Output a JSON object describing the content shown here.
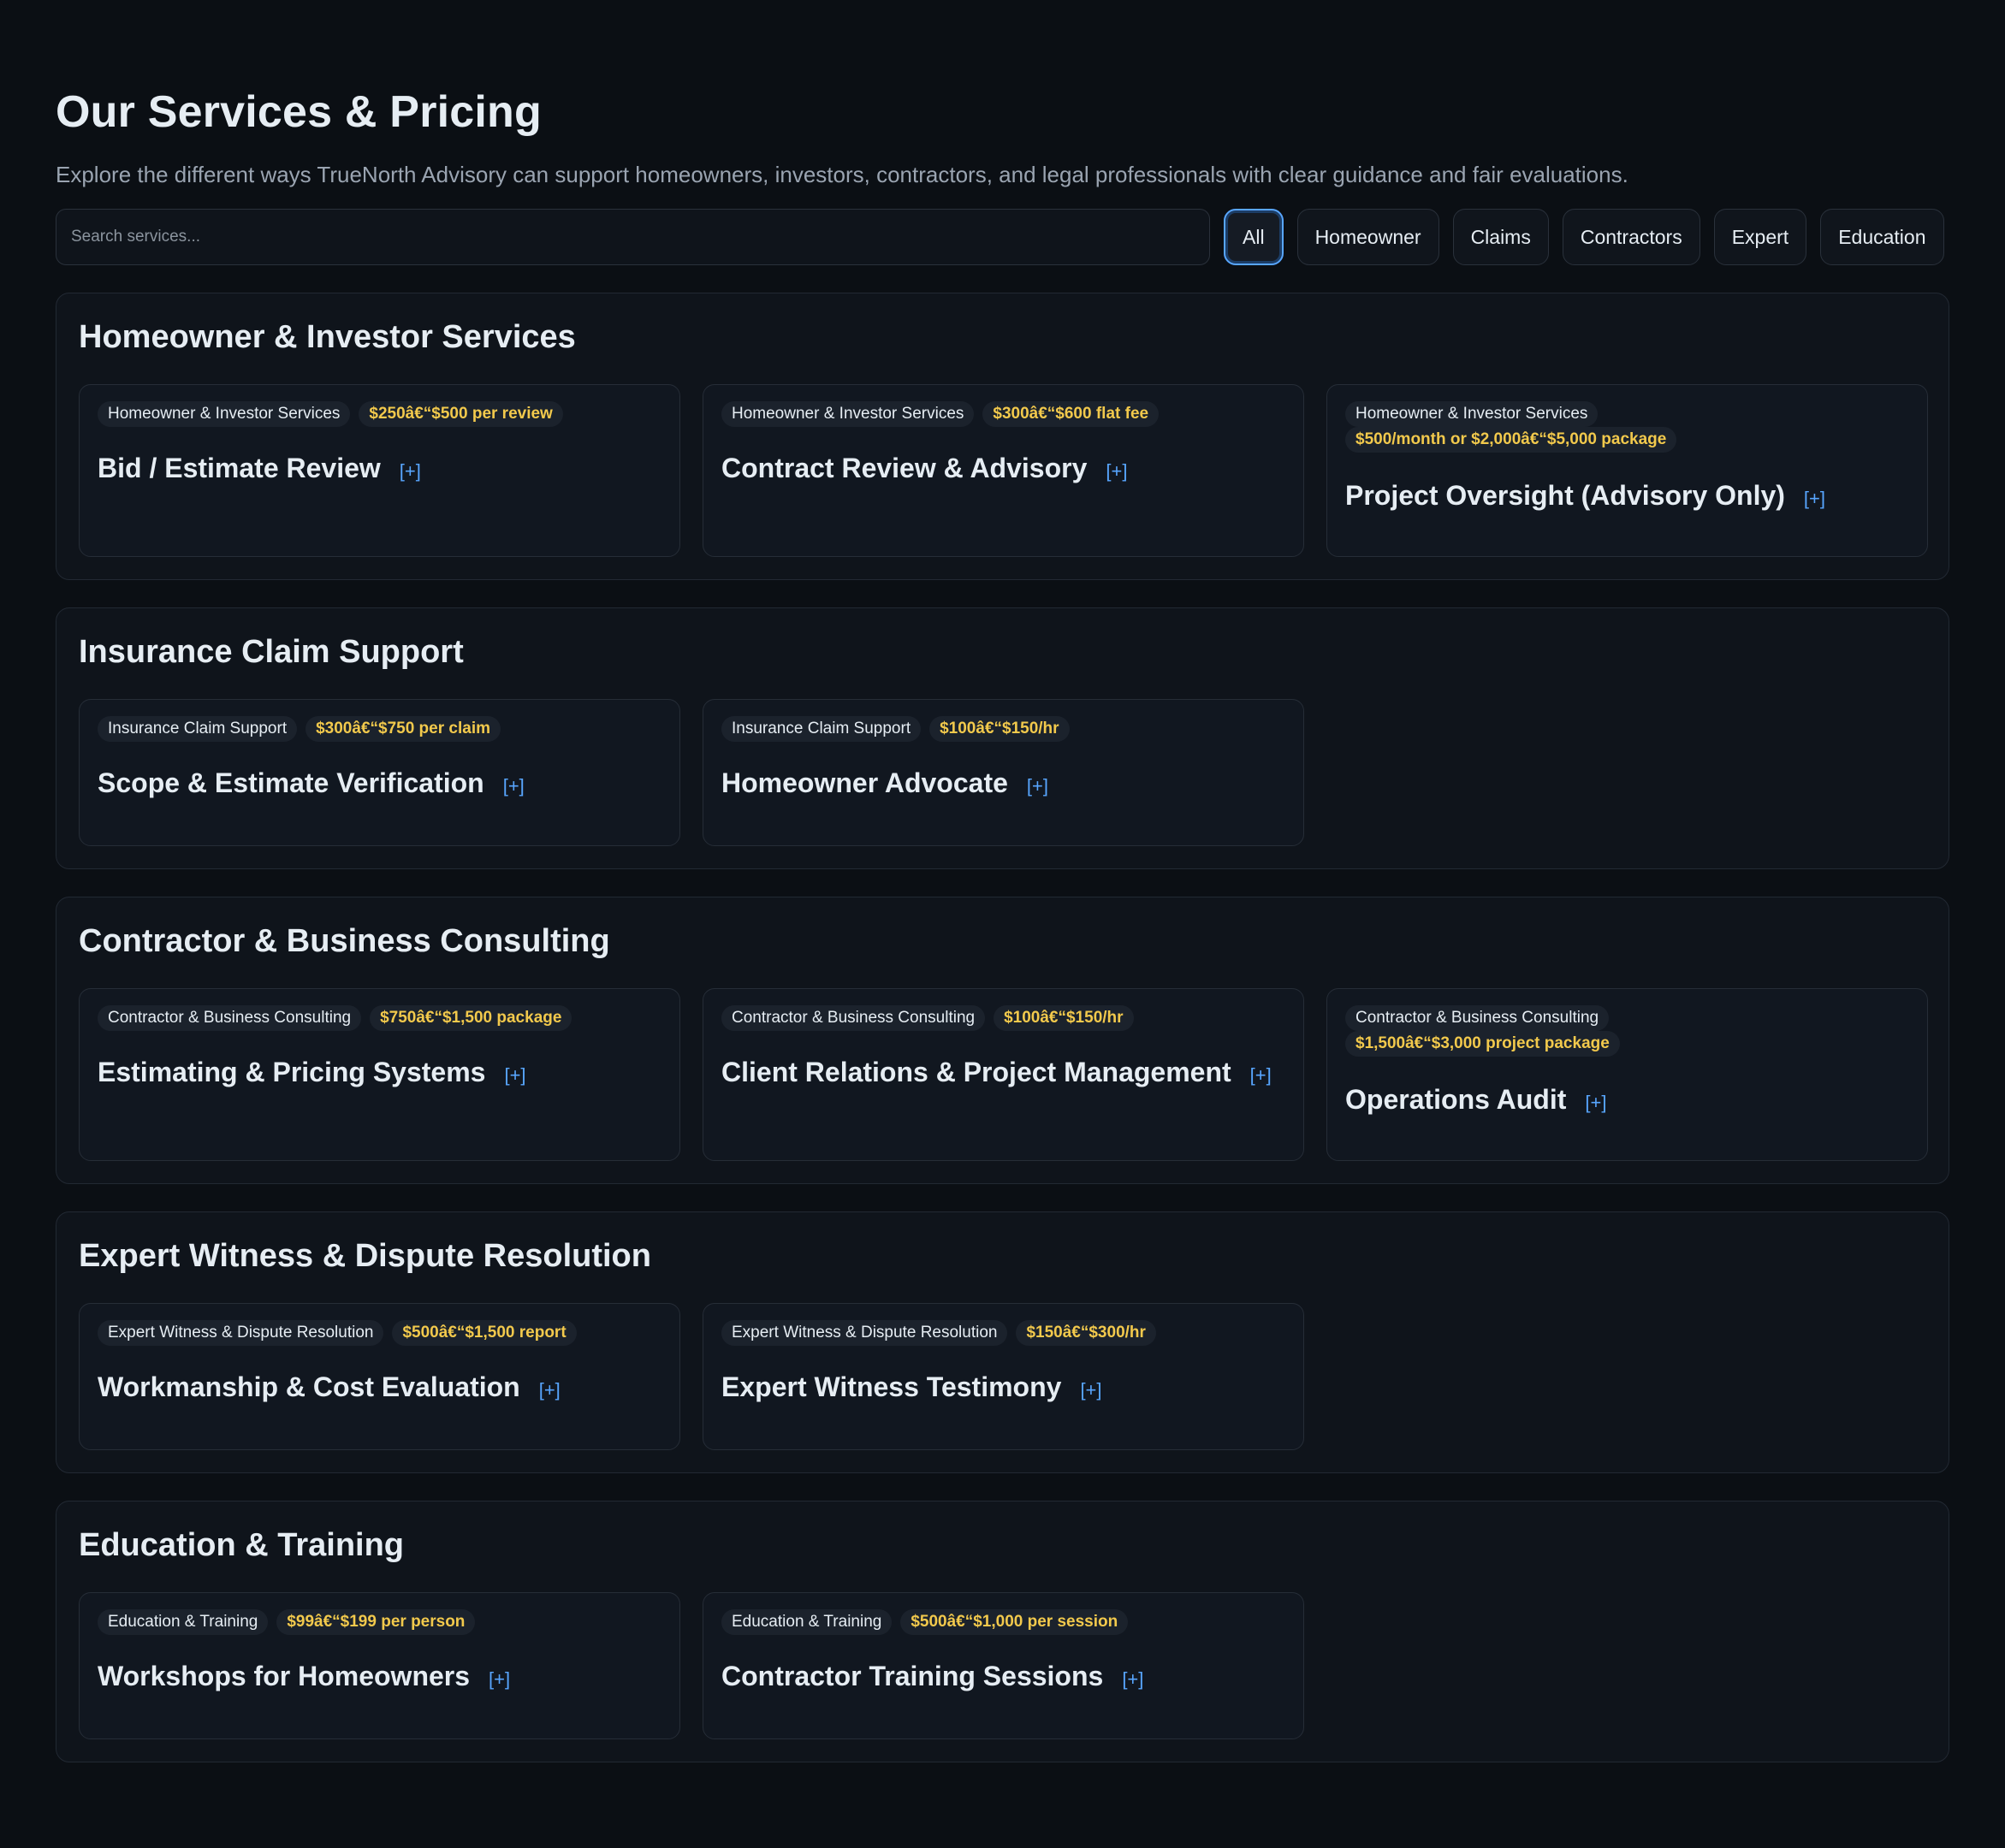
{
  "header": {
    "title": "Our Services & Pricing",
    "subtitle": "Explore the different ways TrueNorth Advisory can support homeowners, investors, contractors, and legal professionals with clear guidance and fair evaluations."
  },
  "search": {
    "placeholder": "Search services...",
    "value": ""
  },
  "filters": [
    "All",
    "Homeowner",
    "Claims",
    "Contractors",
    "Expert",
    "Education"
  ],
  "active_filter": "All",
  "expand_label": "[+]",
  "colors": {
    "background": "#0b0f14",
    "accent": "#58a6ff",
    "price": "#f2c94c"
  },
  "sections": [
    {
      "title": "Homeowner & Investor Services",
      "cards": [
        {
          "category": "Homeowner & Investor Services",
          "price": "$250â€“$500 per review",
          "title": "Bid / Estimate Review"
        },
        {
          "category": "Homeowner & Investor Services",
          "price": "$300â€“$600 flat fee",
          "title": "Contract Review & Advisory"
        },
        {
          "category": "Homeowner & Investor Services",
          "price": "$500/month or $2,000â€“$5,000 package",
          "title": "Project Oversight (Advisory Only)"
        }
      ]
    },
    {
      "title": "Insurance Claim Support",
      "cards": [
        {
          "category": "Insurance Claim Support",
          "price": "$300â€“$750 per claim",
          "title": "Scope & Estimate Verification"
        },
        {
          "category": "Insurance Claim Support",
          "price": "$100â€“$150/hr",
          "title": "Homeowner Advocate"
        }
      ]
    },
    {
      "title": "Contractor & Business Consulting",
      "cards": [
        {
          "category": "Contractor & Business Consulting",
          "price": "$750â€“$1,500 package",
          "title": "Estimating & Pricing Systems"
        },
        {
          "category": "Contractor & Business Consulting",
          "price": "$100â€“$150/hr",
          "title": "Client Relations & Project Management"
        },
        {
          "category": "Contractor & Business Consulting",
          "price": "$1,500â€“$3,000 project package",
          "title": "Operations Audit"
        }
      ]
    },
    {
      "title": "Expert Witness & Dispute Resolution",
      "cards": [
        {
          "category": "Expert Witness & Dispute Resolution",
          "price": "$500â€“$1,500 report",
          "title": "Workmanship & Cost Evaluation"
        },
        {
          "category": "Expert Witness & Dispute Resolution",
          "price": "$150â€“$300/hr",
          "title": "Expert Witness Testimony"
        }
      ]
    },
    {
      "title": "Education & Training",
      "cards": [
        {
          "category": "Education & Training",
          "price": "$99â€“$199 per person",
          "title": "Workshops for Homeowners"
        },
        {
          "category": "Education & Training",
          "price": "$500â€“$1,000 per session",
          "title": "Contractor Training Sessions"
        }
      ]
    }
  ]
}
